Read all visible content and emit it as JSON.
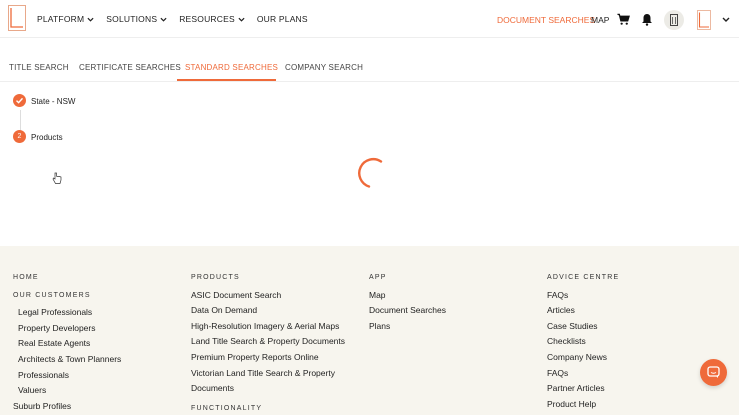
{
  "colors": {
    "accent": "#ef6a3a",
    "footer_bg": "#f7f5ee"
  },
  "header": {
    "nav": [
      {
        "label": "PLATFORM",
        "has_dropdown": true
      },
      {
        "label": "SOLUTIONS",
        "has_dropdown": true
      },
      {
        "label": "RESOURCES",
        "has_dropdown": true
      },
      {
        "label": "OUR PLANS",
        "has_dropdown": false
      }
    ],
    "document_searches": "DOCUMENT SEARCHES",
    "map": "MAP",
    "icons": [
      "cart-icon",
      "bell-icon",
      "building-icon",
      "chevron-down-icon"
    ]
  },
  "tabs": [
    {
      "label": "TITLE SEARCH",
      "active": false
    },
    {
      "label": "CERTIFICATE SEARCHES",
      "active": false
    },
    {
      "label": "STANDARD SEARCHES",
      "active": true
    },
    {
      "label": "COMPANY SEARCH",
      "active": false
    }
  ],
  "steps": [
    {
      "marker": "✓",
      "label": "State - NSW",
      "done": true
    },
    {
      "marker": "2",
      "label": "Products",
      "done": false
    }
  ],
  "footer": {
    "col1": {
      "home": "HOME",
      "heading": "OUR CUSTOMERS",
      "links": [
        "Legal Professionals",
        "Property Developers",
        "Real Estate Agents",
        "Architects & Town Planners",
        "Professionals",
        "Valuers"
      ],
      "extra": "Suburb Profiles"
    },
    "col2": {
      "heading": "PRODUCTS",
      "links": [
        "ASIC Document Search",
        "Data On Demand",
        "High-Resolution Imagery & Aerial Maps",
        "Land Title Search & Property Documents",
        "Premium Property Reports Online",
        "Victorian Land Title Search & Property",
        "Documents"
      ],
      "heading2": "FUNCTIONALITY"
    },
    "col3": {
      "heading": "APP",
      "links": [
        "Map",
        "Document Searches",
        "Plans"
      ]
    },
    "col4": {
      "heading": "ADVICE CENTRE",
      "links": [
        "FAQs",
        "Articles",
        "Case Studies",
        "Checklists",
        "Company News",
        "FAQs",
        "Partner Articles",
        "Product Help"
      ]
    }
  }
}
